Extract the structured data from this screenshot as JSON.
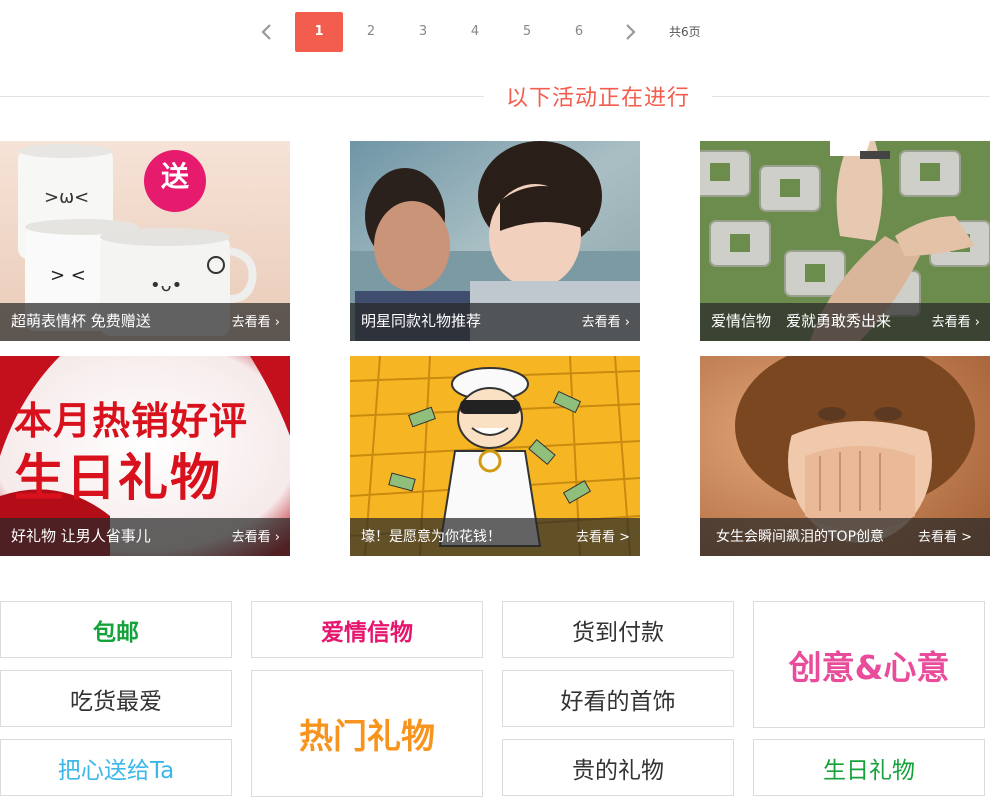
{
  "pagination": {
    "pages": [
      "1",
      "2",
      "3",
      "4",
      "5",
      "6"
    ],
    "active": "1",
    "total_label": "共6页",
    "prev_icon": "chevron-left-icon",
    "next_icon": "chevron-right-icon"
  },
  "section": {
    "title": "以下活动正在进行"
  },
  "promos": [
    {
      "caption": "超萌表情杯 免费赠送",
      "more": "去看看 ›",
      "badge": "送"
    },
    {
      "caption": "明星同款礼物推荐",
      "more": "去看看 ›"
    },
    {
      "caption": "爱情信物　爱就勇敢秀出来",
      "more": "去看看 ›"
    },
    {
      "caption": "好礼物 让男人省事儿",
      "more": "去看看 ›",
      "banner_line1": "本月热销好评",
      "banner_line2": "生日礼物"
    },
    {
      "caption": "壕！是愿意为你花钱！",
      "more": "去看看 >"
    },
    {
      "caption": "女生会瞬间飙泪的TOP创意",
      "more": "去看看 >"
    }
  ],
  "categories": [
    {
      "label": "包邮",
      "color": "#16a23a"
    },
    {
      "label": "爱情信物",
      "color": "#e6166f"
    },
    {
      "label": "货到付款",
      "color": "#333333"
    },
    {
      "label": "创意&心意",
      "color": "#e94c9a"
    },
    {
      "label": "吃货最爱",
      "color": "#333333"
    },
    {
      "label": "热门礼物",
      "color": "#f7941d"
    },
    {
      "label": "好看的首饰",
      "color": "#333333"
    },
    {
      "label": "把心送给Ta",
      "color": "#3bb8e8"
    },
    {
      "label": "贵的礼物",
      "color": "#333333"
    },
    {
      "label": "生日礼物",
      "color": "#16a23a"
    }
  ],
  "colors": {
    "accent": "#f25d4e",
    "border": "#dcdcdc"
  }
}
